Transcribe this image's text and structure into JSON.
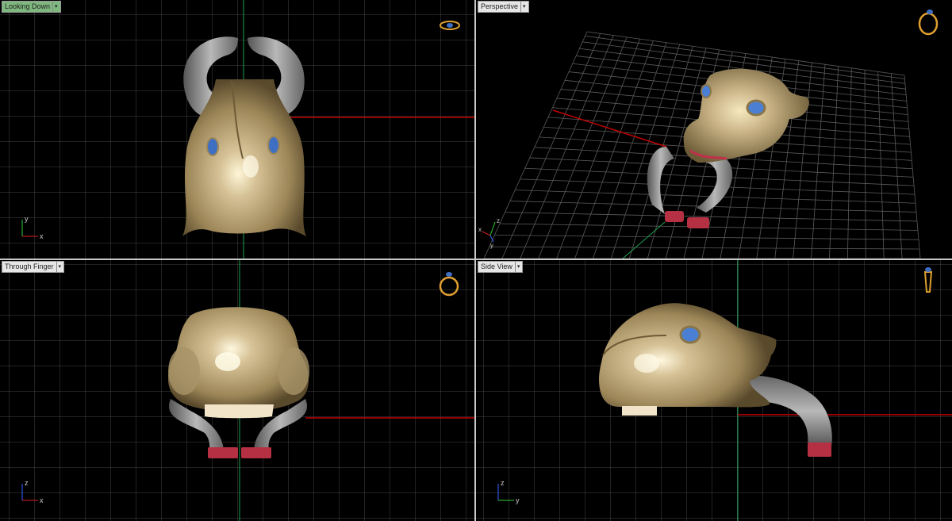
{
  "viewports": {
    "top_left": {
      "label": "Looking Down",
      "active": true
    },
    "top_right": {
      "label": "Perspective",
      "active": false
    },
    "bottom_left": {
      "label": "Through Finger",
      "active": false
    },
    "bottom_right": {
      "label": "Side View",
      "active": false
    }
  },
  "axis_labels": {
    "top_left": {
      "v": "y",
      "h": "x"
    },
    "top_right": {
      "a": "z",
      "b": "y",
      "c": "x"
    },
    "bottom_left": {
      "v": "z",
      "h": "x"
    },
    "bottom_right": {
      "v": "z",
      "h": "y"
    }
  },
  "icons": {
    "top_left": "ring-top-view-icon",
    "top_right": "ring-perspective-icon",
    "bottom_left": "ring-front-view-icon",
    "bottom_right": "ring-side-view-icon"
  },
  "colors": {
    "grid": "#4a4a4a",
    "axis_x": "#c00000",
    "axis_y": "#1fa050",
    "gold": "#c2ad82",
    "silver": "#8a8a8a",
    "gem": "#3f6fc2",
    "active_tab": "#7fb87f"
  }
}
